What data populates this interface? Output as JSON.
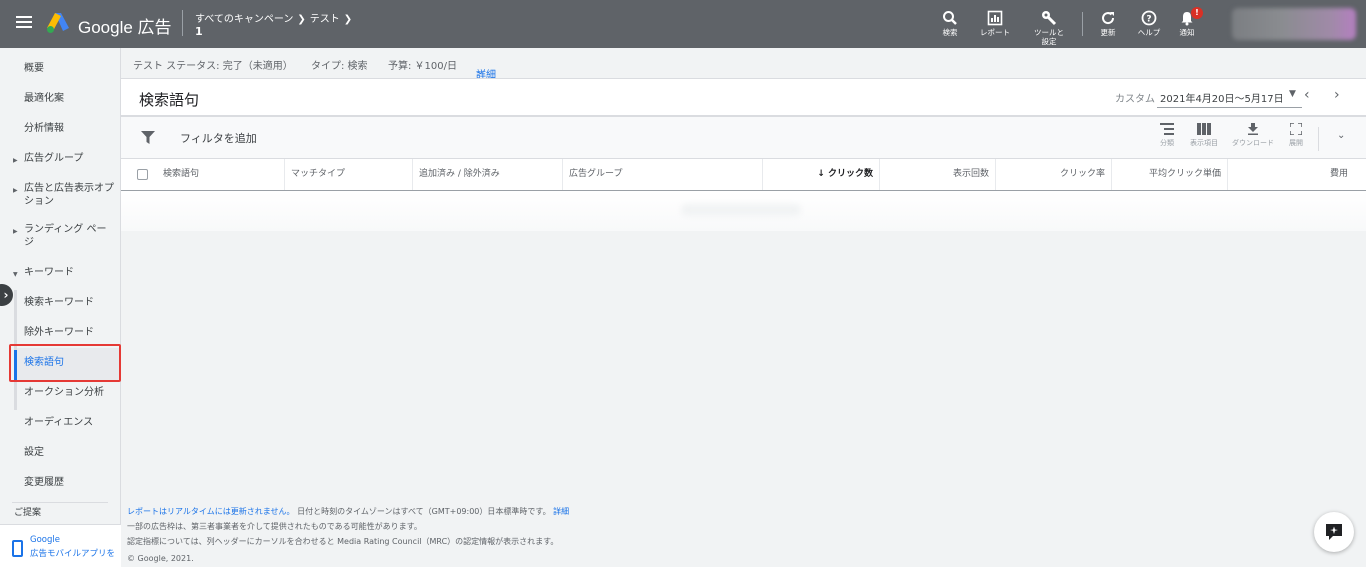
{
  "header": {
    "brand": "Google 広告",
    "breadcrumb": [
      "すべてのキャンペーン",
      "テスト"
    ],
    "breadcrumb_sub": "1",
    "tools": [
      {
        "label": "検索",
        "icon": "search-icon"
      },
      {
        "label": "レポート",
        "icon": "report-icon"
      },
      {
        "label": "ツールと\n設定",
        "icon": "wrench-icon"
      },
      {
        "label": "更新",
        "icon": "refresh-icon"
      },
      {
        "label": "ヘルプ",
        "icon": "help-icon"
      },
      {
        "label": "通知",
        "icon": "bell-icon"
      }
    ],
    "notification_badge": "!"
  },
  "sidebar": {
    "items": [
      {
        "label": "概要"
      },
      {
        "label": "最適化案"
      },
      {
        "label": "分析情報"
      },
      {
        "label": "広告グループ"
      },
      {
        "label": "広告と広告表示オプション"
      },
      {
        "label": "ランディング ページ"
      },
      {
        "label": "キーワード"
      },
      {
        "label": "検索キーワード"
      },
      {
        "label": "除外キーワード"
      },
      {
        "label": "検索語句"
      },
      {
        "label": "オークション分析"
      },
      {
        "label": "オーディエンス"
      },
      {
        "label": "設定"
      },
      {
        "label": "変更履歴"
      },
      {
        "label": "ご提案"
      }
    ],
    "app_promo_line1": "Google",
    "app_promo_line2": "広告モバイルアプリを"
  },
  "status": {
    "test_status": "テスト ステータス: 完了（未適用）",
    "type": "タイプ: 検索",
    "budget": "予算: ￥100/日",
    "details": "詳細"
  },
  "main": {
    "title": "検索語句",
    "date_label": "カスタム",
    "date_range": "2021年4月20日～5月17日",
    "filter_placeholder": "フィルタを追加",
    "toolbar": [
      {
        "label": "分類",
        "icon": "segment-icon"
      },
      {
        "label": "表示項目",
        "icon": "columns-icon"
      },
      {
        "label": "ダウンロード",
        "icon": "download-icon"
      },
      {
        "label": "展開",
        "icon": "expand-icon"
      }
    ],
    "columns": [
      "検索語句",
      "マッチタイプ",
      "追加済み / 除外済み",
      "広告グループ",
      "クリック数",
      "表示回数",
      "クリック率",
      "平均クリック単価",
      "費用"
    ]
  },
  "footer": {
    "line1_link": "レポートはリアルタイムには更新されません。",
    "line1_text": " 日付と時刻のタイムゾーンはすべて（GMT+09:00）日本標準時です。 ",
    "line1_link2": "詳細",
    "line2": "一部の広告枠は、第三者事業者を介して提供されたものである可能性があります。",
    "line3": "認定指標については、列ヘッダーにカーソルを合わせると Media Rating Council（MRC）の認定情報が表示されます。",
    "line4": "© Google, 2021."
  },
  "colors": {
    "header_bg": "#5f6368",
    "accent": "#1a73e8",
    "highlight": "#e53935",
    "badge": "#d93025"
  }
}
